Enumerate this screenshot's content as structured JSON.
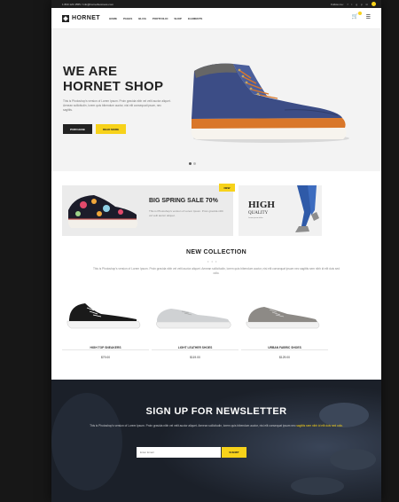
{
  "topbar": {
    "contact": "1 800 123 4555 / info@hornetbusiness.com",
    "follow_label": "Follow me:",
    "social_icons": [
      "facebook-icon",
      "twitter-icon",
      "google-plus-icon",
      "pinterest-icon",
      "linkedin-icon"
    ]
  },
  "nav": {
    "logo": "HORNET",
    "menu": [
      "HOME",
      "PAGES",
      "BLOG",
      "PORTFOLIO",
      "SHOP",
      "ELEMENTS"
    ]
  },
  "hero": {
    "title": "WE ARE\nHORNET SHOP",
    "text": "This is Photoshop's version of Lorem Ipsum. Proin gravida nibh vel velit auctor aliquet. Aenean sollicitudin, lorem quis bibendum auctor, nisi elit consequat ipsum, nec sagittis.",
    "btn_primary": "PURCHASE",
    "btn_secondary": "READ MORE",
    "slides": 2,
    "active_slide": 1
  },
  "promo": {
    "sale_title": "BIG SPRING SALE 70%",
    "sale_text": "This is Photoshop's version of Lorem Ipsum. Proin gravida nibh vel velit auctor aliquet.",
    "new_badge": "NEW",
    "quality_title": "HIGH",
    "quality_sub": "QUALITY",
    "quality_small": "Lorem ipsum dolor"
  },
  "collection": {
    "title": "NEW COLLECTION",
    "divider": "• • •",
    "text": "This is Photoshop's version of Lorem Ipsum. Proin gravida nibh vel velit auctor aliquet. Aenean sollicitudin, lorem quis bibendum auctor, nisi elit consequat ipsum nec sagittis sem nibh id elit duis sed odio.",
    "products": [
      {
        "name": "HIGH TOP SNEAKERS",
        "price": "$79.00"
      },
      {
        "name": "LIGHT LEATHER SHOES",
        "price": "$119.00"
      },
      {
        "name": "URBAN FABRIC SHOES",
        "price": "$129.00"
      }
    ]
  },
  "newsletter": {
    "title": "SIGN UP FOR NEWSLETTER",
    "text": "This is Photoshop's version of Lorem Ipsum. Proin gravida nibh vel velit auctor aliquet. Aenean sollicitudin, lorem quis bibendum auctor, nisi elit consequat ipsum nec",
    "text_highlight": "sagittis sem nibh id elit duis sed odio.",
    "placeholder": "Enter Email",
    "button": "SUBMIT"
  },
  "colors": {
    "accent": "#f7d21a",
    "dark": "#222222",
    "footer_bg": "#1b2029"
  }
}
